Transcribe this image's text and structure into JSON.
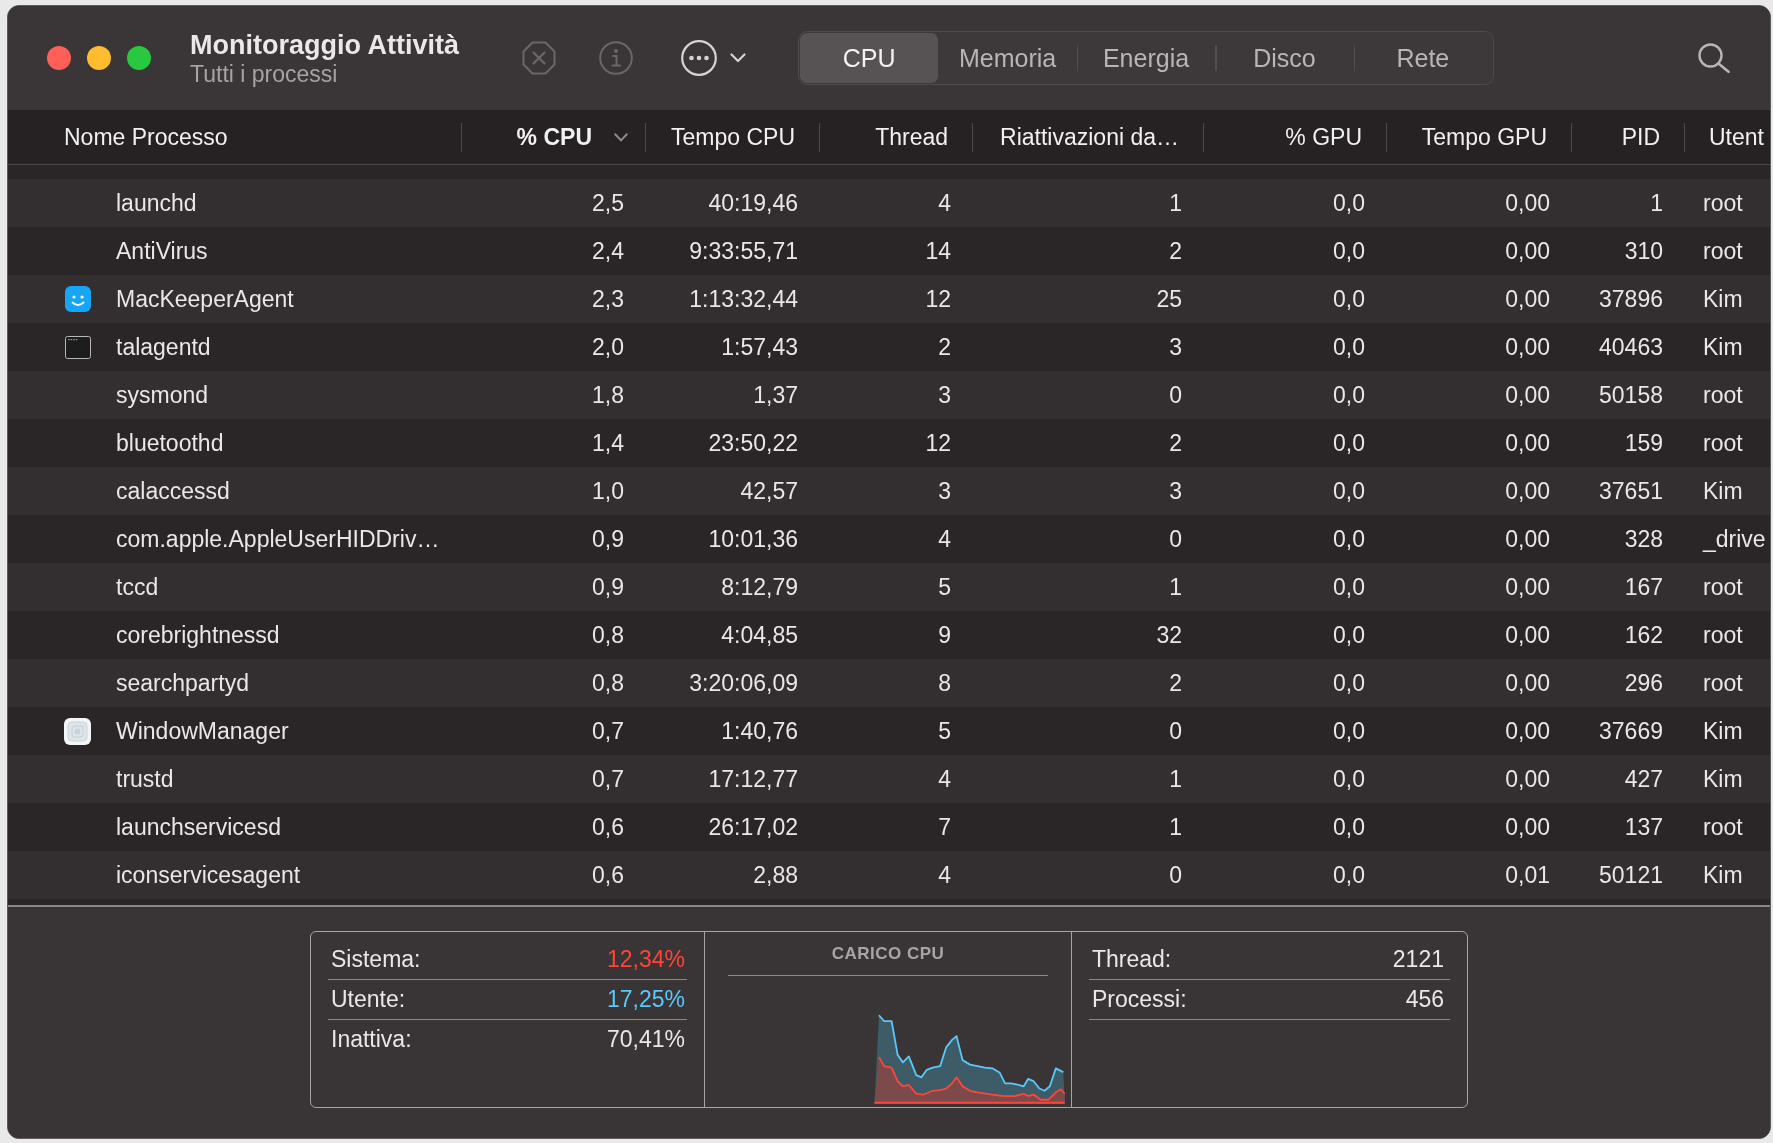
{
  "window": {
    "title": "Monitoraggio Attività",
    "subtitle": "Tutti i processi"
  },
  "toolbar": [
    {
      "kind": "stop",
      "disabled": true
    },
    {
      "kind": "info",
      "disabled": true
    },
    {
      "kind": "more",
      "disabled": false
    }
  ],
  "tabs": [
    {
      "label": "CPU",
      "selected": true
    },
    {
      "label": "Memoria",
      "selected": false
    },
    {
      "label": "Energia",
      "selected": false
    },
    {
      "label": "Disco",
      "selected": false
    },
    {
      "label": "Rete",
      "selected": false
    }
  ],
  "table": {
    "columns": [
      {
        "label": "Nome Processo",
        "sorted": false
      },
      {
        "label": "% CPU",
        "sorted": true
      },
      {
        "label": "Tempo CPU",
        "sorted": false
      },
      {
        "label": "Thread",
        "sorted": false
      },
      {
        "label": "Riattivazioni da…",
        "sorted": false
      },
      {
        "label": "% GPU",
        "sorted": false
      },
      {
        "label": "Tempo GPU",
        "sorted": false
      },
      {
        "label": "PID",
        "sorted": false
      },
      {
        "label": "Utent",
        "sorted": false
      }
    ],
    "rows": [
      {
        "kind": "plain",
        "selected": false,
        "cells": [
          "launchd",
          "2,5",
          "40:19,46",
          "4",
          "1",
          "0,0",
          "0,00",
          "1",
          "root"
        ]
      },
      {
        "kind": "plain",
        "selected": false,
        "cells": [
          "AntiVirus",
          "2,4",
          "9:33:55,71",
          "14",
          "2",
          "0,0",
          "0,00",
          "310",
          "root"
        ]
      },
      {
        "kind": "app",
        "selected": false,
        "cells": [
          "MacKeeperAgent",
          "2,3",
          "1:13:32,44",
          "12",
          "25",
          "0,0",
          "0,00",
          "37896",
          "Kim"
        ]
      },
      {
        "kind": "tool",
        "selected": false,
        "cells": [
          "talagentd",
          "2,0",
          "1:57,43",
          "2",
          "3",
          "0,0",
          "0,00",
          "40463",
          "Kim"
        ]
      },
      {
        "kind": "plain",
        "selected": false,
        "cells": [
          "sysmond",
          "1,8",
          "1,37",
          "3",
          "0",
          "0,0",
          "0,00",
          "50158",
          "root"
        ]
      },
      {
        "kind": "plain",
        "selected": false,
        "cells": [
          "bluetoothd",
          "1,4",
          "23:50,22",
          "12",
          "2",
          "0,0",
          "0,00",
          "159",
          "root"
        ]
      },
      {
        "kind": "plain",
        "selected": false,
        "cells": [
          "calaccessd",
          "1,0",
          "42,57",
          "3",
          "3",
          "0,0",
          "0,00",
          "37651",
          "Kim"
        ]
      },
      {
        "kind": "plain",
        "selected": false,
        "cells": [
          "com.apple.AppleUserHIDDriv…",
          "0,9",
          "10:01,36",
          "4",
          "0",
          "0,0",
          "0,00",
          "328",
          "_drive"
        ]
      },
      {
        "kind": "plain",
        "selected": false,
        "cells": [
          "tccd",
          "0,9",
          "8:12,79",
          "5",
          "1",
          "0,0",
          "0,00",
          "167",
          "root"
        ]
      },
      {
        "kind": "plain",
        "selected": false,
        "cells": [
          "corebrightnessd",
          "0,8",
          "4:04,85",
          "9",
          "32",
          "0,0",
          "0,00",
          "162",
          "root"
        ]
      },
      {
        "kind": "plain",
        "selected": false,
        "cells": [
          "searchpartyd",
          "0,8",
          "3:20:06,09",
          "8",
          "2",
          "0,0",
          "0,00",
          "296",
          "root"
        ]
      },
      {
        "kind": "system",
        "selected": false,
        "cells": [
          "WindowManager",
          "0,7",
          "1:40,76",
          "5",
          "0",
          "0,0",
          "0,00",
          "37669",
          "Kim"
        ]
      },
      {
        "kind": "plain",
        "selected": false,
        "cells": [
          "trustd",
          "0,7",
          "17:12,77",
          "4",
          "1",
          "0,0",
          "0,00",
          "427",
          "Kim"
        ]
      },
      {
        "kind": "plain",
        "selected": false,
        "cells": [
          "launchservicesd",
          "0,6",
          "26:17,02",
          "7",
          "1",
          "0,0",
          "0,00",
          "137",
          "root"
        ]
      },
      {
        "kind": "plain",
        "selected": false,
        "cells": [
          "iconservicesagent",
          "0,6",
          "2,88",
          "4",
          "0",
          "0,0",
          "0,01",
          "50121",
          "Kim"
        ]
      }
    ]
  },
  "summary": {
    "stats": [
      {
        "label": "Sistema:",
        "value": "12,34%",
        "color": "#ff453a"
      },
      {
        "label": "Utente:",
        "value": "17,25%",
        "color": "#5ac8fa"
      },
      {
        "label": "Inattiva:",
        "value": "70,41%",
        "color": "#ebe7e7"
      }
    ],
    "chart_title": "CARICO CPU",
    "counts": [
      {
        "label": "Thread:",
        "value": "2121"
      },
      {
        "label": "Processi:",
        "value": "456"
      }
    ]
  }
}
